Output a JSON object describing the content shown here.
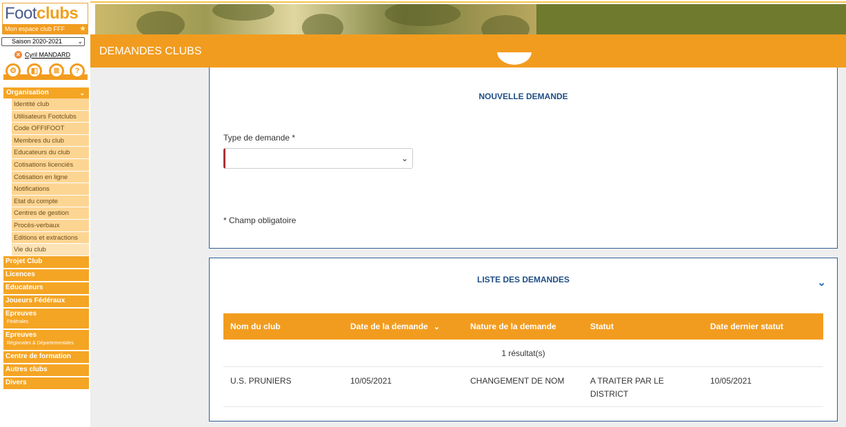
{
  "logo": {
    "brand_a": "Foot",
    "brand_b": "clubs",
    "tagline": "Mon espace club FFF"
  },
  "season": {
    "selected": "Saison 2020-2021"
  },
  "user": {
    "name": "Cyril MANDARD"
  },
  "menu": {
    "section": "Organisation",
    "items": [
      "Identité club",
      "Utilisateurs Footclubs",
      "Code OFFIFOOT",
      "Membres du club",
      "Educateurs du club",
      "Cotisations licenciés",
      "Cotisation en ligne",
      "Notifications",
      "Etat du compte",
      "Centres de gestion",
      "Procès-verbaux",
      "Editions et extractions",
      "Vie du club"
    ],
    "categories": [
      {
        "label": "Projet Club",
        "sub": ""
      },
      {
        "label": "Licences",
        "sub": ""
      },
      {
        "label": "Educateurs",
        "sub": ""
      },
      {
        "label": "Joueurs Fédéraux",
        "sub": ""
      },
      {
        "label": "Epreuves",
        "sub": "Fédérales"
      },
      {
        "label": "Epreuves",
        "sub": "Régionales & Départementales"
      },
      {
        "label": "Centre de formation",
        "sub": ""
      },
      {
        "label": "Autres clubs",
        "sub": ""
      },
      {
        "label": "Divers",
        "sub": ""
      }
    ]
  },
  "header": {
    "title": "DEMANDES CLUBS"
  },
  "new_request": {
    "title": "NOUVELLE DEMANDE",
    "type_label": "Type de demande *",
    "type_value": "",
    "required_note": "* Champ obligatoire"
  },
  "list": {
    "title": "LISTE DES DEMANDES",
    "columns": [
      "Nom du club",
      "Date de la demande",
      "Nature de la demande",
      "Statut",
      "Date dernier statut"
    ],
    "result_count": "1 résultat(s)",
    "rows": [
      [
        "U.S. PRUNIERS",
        "10/05/2021",
        "CHANGEMENT DE NOM",
        "A TRAITER PAR LE DISTRICT",
        "10/05/2021"
      ]
    ]
  },
  "colors": {
    "accent": "#f29c1f",
    "navy": "#1e4e86",
    "olive": "#6f7a2e"
  },
  "icons": [
    "close-icon",
    "settings-icon",
    "documents-icon",
    "list-icon",
    "help-icon",
    "chevron-down-icon"
  ]
}
